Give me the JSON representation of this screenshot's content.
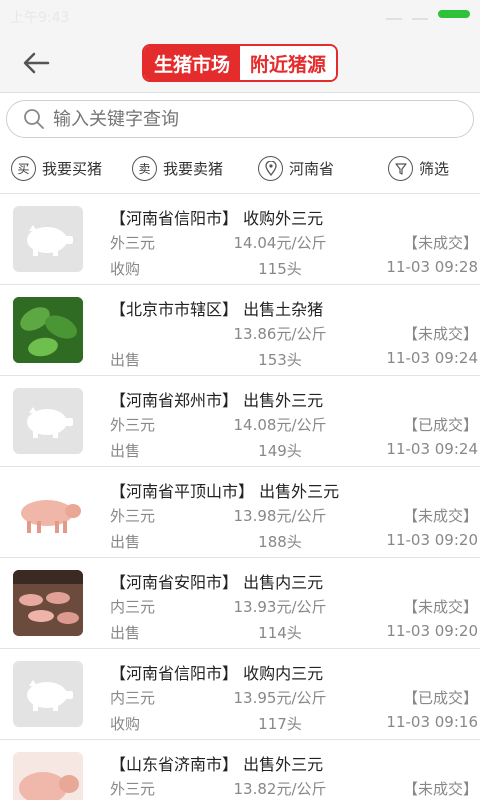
{
  "status_bar": {
    "time": "上午9:43"
  },
  "header": {
    "tab_active": "生猪市场",
    "tab_inactive": "附近猪源"
  },
  "search": {
    "placeholder": "输入关键字查询"
  },
  "filters": [
    {
      "icon": "买",
      "label": "我要买猪"
    },
    {
      "icon": "卖",
      "label": "我要卖猪"
    },
    {
      "label": "河南省"
    },
    {
      "label": "筛选"
    }
  ],
  "colors": {
    "accent": "#e42c2c"
  },
  "listings": [
    {
      "title": "【河南省信阳市】 收购外三元",
      "breed": "外三元",
      "price": "14.04元/公斤",
      "status": "【未成交】",
      "type": "收购",
      "qty": "115头",
      "time": "11-03 09:28",
      "thumb": "placeholder"
    },
    {
      "title": "【北京市市辖区】 出售土杂猪",
      "breed": "",
      "price": "13.86元/公斤",
      "status": "【未成交】",
      "type": "出售",
      "qty": "153头",
      "time": "11-03 09:24",
      "thumb": "leaf"
    },
    {
      "title": "【河南省郑州市】 出售外三元",
      "breed": "外三元",
      "price": "14.08元/公斤",
      "status": "【已成交】",
      "type": "出售",
      "qty": "149头",
      "time": "11-03 09:24",
      "thumb": "placeholder"
    },
    {
      "title": "【河南省平顶山市】 出售外三元",
      "breed": "外三元",
      "price": "13.98元/公斤",
      "status": "【未成交】",
      "type": "出售",
      "qty": "188头",
      "time": "11-03 09:20",
      "thumb": "pig"
    },
    {
      "title": "【河南省安阳市】 出售内三元",
      "breed": "内三元",
      "price": "13.93元/公斤",
      "status": "【未成交】",
      "type": "出售",
      "qty": "114头",
      "time": "11-03 09:20",
      "thumb": "farm"
    },
    {
      "title": "【河南省信阳市】 收购内三元",
      "breed": "内三元",
      "price": "13.95元/公斤",
      "status": "【已成交】",
      "type": "收购",
      "qty": "117头",
      "time": "11-03 09:16",
      "thumb": "placeholder"
    },
    {
      "title": "【山东省济南市】 出售外三元",
      "breed": "外三元",
      "price": "13.82元/公斤",
      "status": "【未成交】",
      "type": "",
      "qty": "",
      "time": "",
      "thumb": "pig"
    }
  ]
}
